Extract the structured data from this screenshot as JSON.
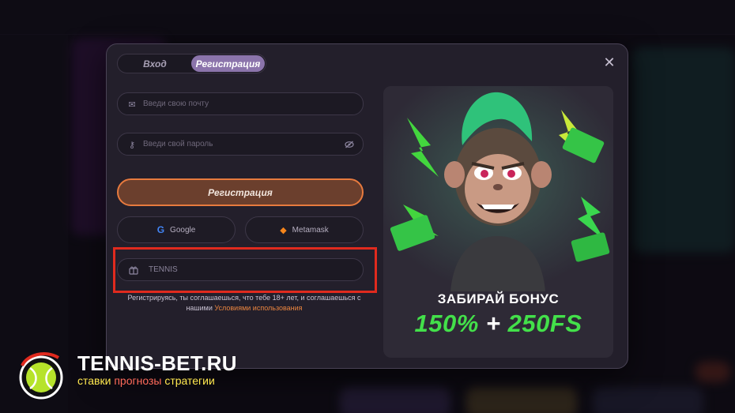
{
  "tabs": {
    "login": "Вход",
    "register": "Регистрация",
    "active": "register"
  },
  "form": {
    "email_placeholder": "Введи свою почту",
    "password_placeholder": "Введи свой пароль",
    "register_button": "Регистрация",
    "google_label": "Google",
    "metamask_label": "Metamask",
    "promo_value": "TENNIS",
    "terms_text": "Регистрируясь, ты соглашаешься, что тебе 18+ лет, и соглашаешься с нашими",
    "terms_link": "Условиями использования"
  },
  "promo": {
    "title": "ЗАБИРАЙ БОНУС",
    "bonus_left": "150%",
    "bonus_plus": "+",
    "bonus_right": "250FS"
  },
  "watermark": {
    "name": "TENNIS-BET.RU",
    "tag_1": "ставки",
    "tag_2": "прогнозы",
    "tag_3": "стратегии"
  },
  "colors": {
    "accent": "#e77a3e",
    "tab_active": "#8b74ab",
    "bonus_green": "#43e04a",
    "highlight": "#e02a1e"
  },
  "icons": {
    "close": "close-icon",
    "email": "mail-icon",
    "password": "key-icon",
    "toggle": "eye-off-icon",
    "google": "google-icon",
    "metamask": "metamask-icon",
    "promo": "gift-icon"
  }
}
